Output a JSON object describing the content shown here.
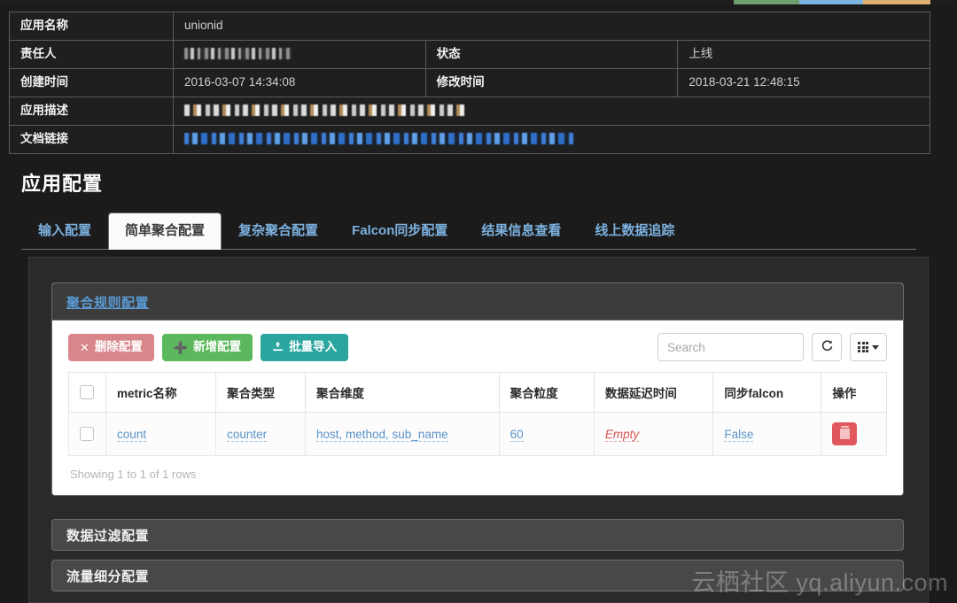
{
  "top_strip": {
    "colors": [
      "#1d1d1d",
      "#6f9f6c",
      "#7db5e0",
      "#e0b070"
    ]
  },
  "info_table": {
    "rows": [
      {
        "label": "应用名称",
        "value": "unionid",
        "redacted": false,
        "label2": "",
        "value2": ""
      },
      {
        "label": "责任人",
        "value": "",
        "redacted": true,
        "label2": "状态",
        "value2": "上线"
      },
      {
        "label": "创建时间",
        "value": "2016-03-07 14:34:08",
        "redacted": false,
        "label2": "修改时间",
        "value2": "2018-03-21 12:48:15"
      },
      {
        "label": "应用描述",
        "value": "",
        "redacted": true,
        "label2": "",
        "value2": ""
      },
      {
        "label": "文档链接",
        "value": "",
        "redacted": true,
        "label2": "",
        "value2": ""
      }
    ]
  },
  "section": {
    "title": "应用配置"
  },
  "tabs": [
    {
      "label": "输入配置",
      "active": false
    },
    {
      "label": "简单聚合配置",
      "active": true
    },
    {
      "label": "复杂聚合配置",
      "active": false
    },
    {
      "label": "Falcon同步配置",
      "active": false
    },
    {
      "label": "结果信息查看",
      "active": false
    },
    {
      "label": "线上数据追踪",
      "active": false
    }
  ],
  "aggregation_card": {
    "header_title": "聚合规则配置",
    "toolbar": {
      "delete_label": "删除配置",
      "delete_icon": "close-icon",
      "delete_color": "#d9868b",
      "add_label": "新增配置",
      "add_icon": "plus-icon",
      "add_color": "#5cb85c",
      "import_label": "批量导入",
      "import_icon": "import-icon",
      "import_color": "#2aa5a0",
      "search_placeholder": "Search",
      "search_value": "",
      "refresh_icon": "refresh-icon",
      "columns_icon": "grid-icon"
    },
    "table": {
      "columns": [
        "",
        "metric名称",
        "聚合类型",
        "聚合维度",
        "聚合粒度",
        "数据延迟时间",
        "同步falcon",
        "操作"
      ],
      "rows": [
        {
          "metric": "count",
          "agg_type": "counter",
          "dimension": "host, method, sub_name",
          "granularity": "60",
          "delay": "Empty",
          "delay_is_empty": true,
          "falcon": "False",
          "action_icon": "trash-icon"
        }
      ],
      "footer": "Showing 1 to 1 of 1 rows"
    }
  },
  "collapsed_cards": [
    {
      "title": "数据过滤配置"
    },
    {
      "title": "流量细分配置"
    }
  ],
  "watermark": {
    "text": "云栖社区 yq.aliyun.com"
  }
}
